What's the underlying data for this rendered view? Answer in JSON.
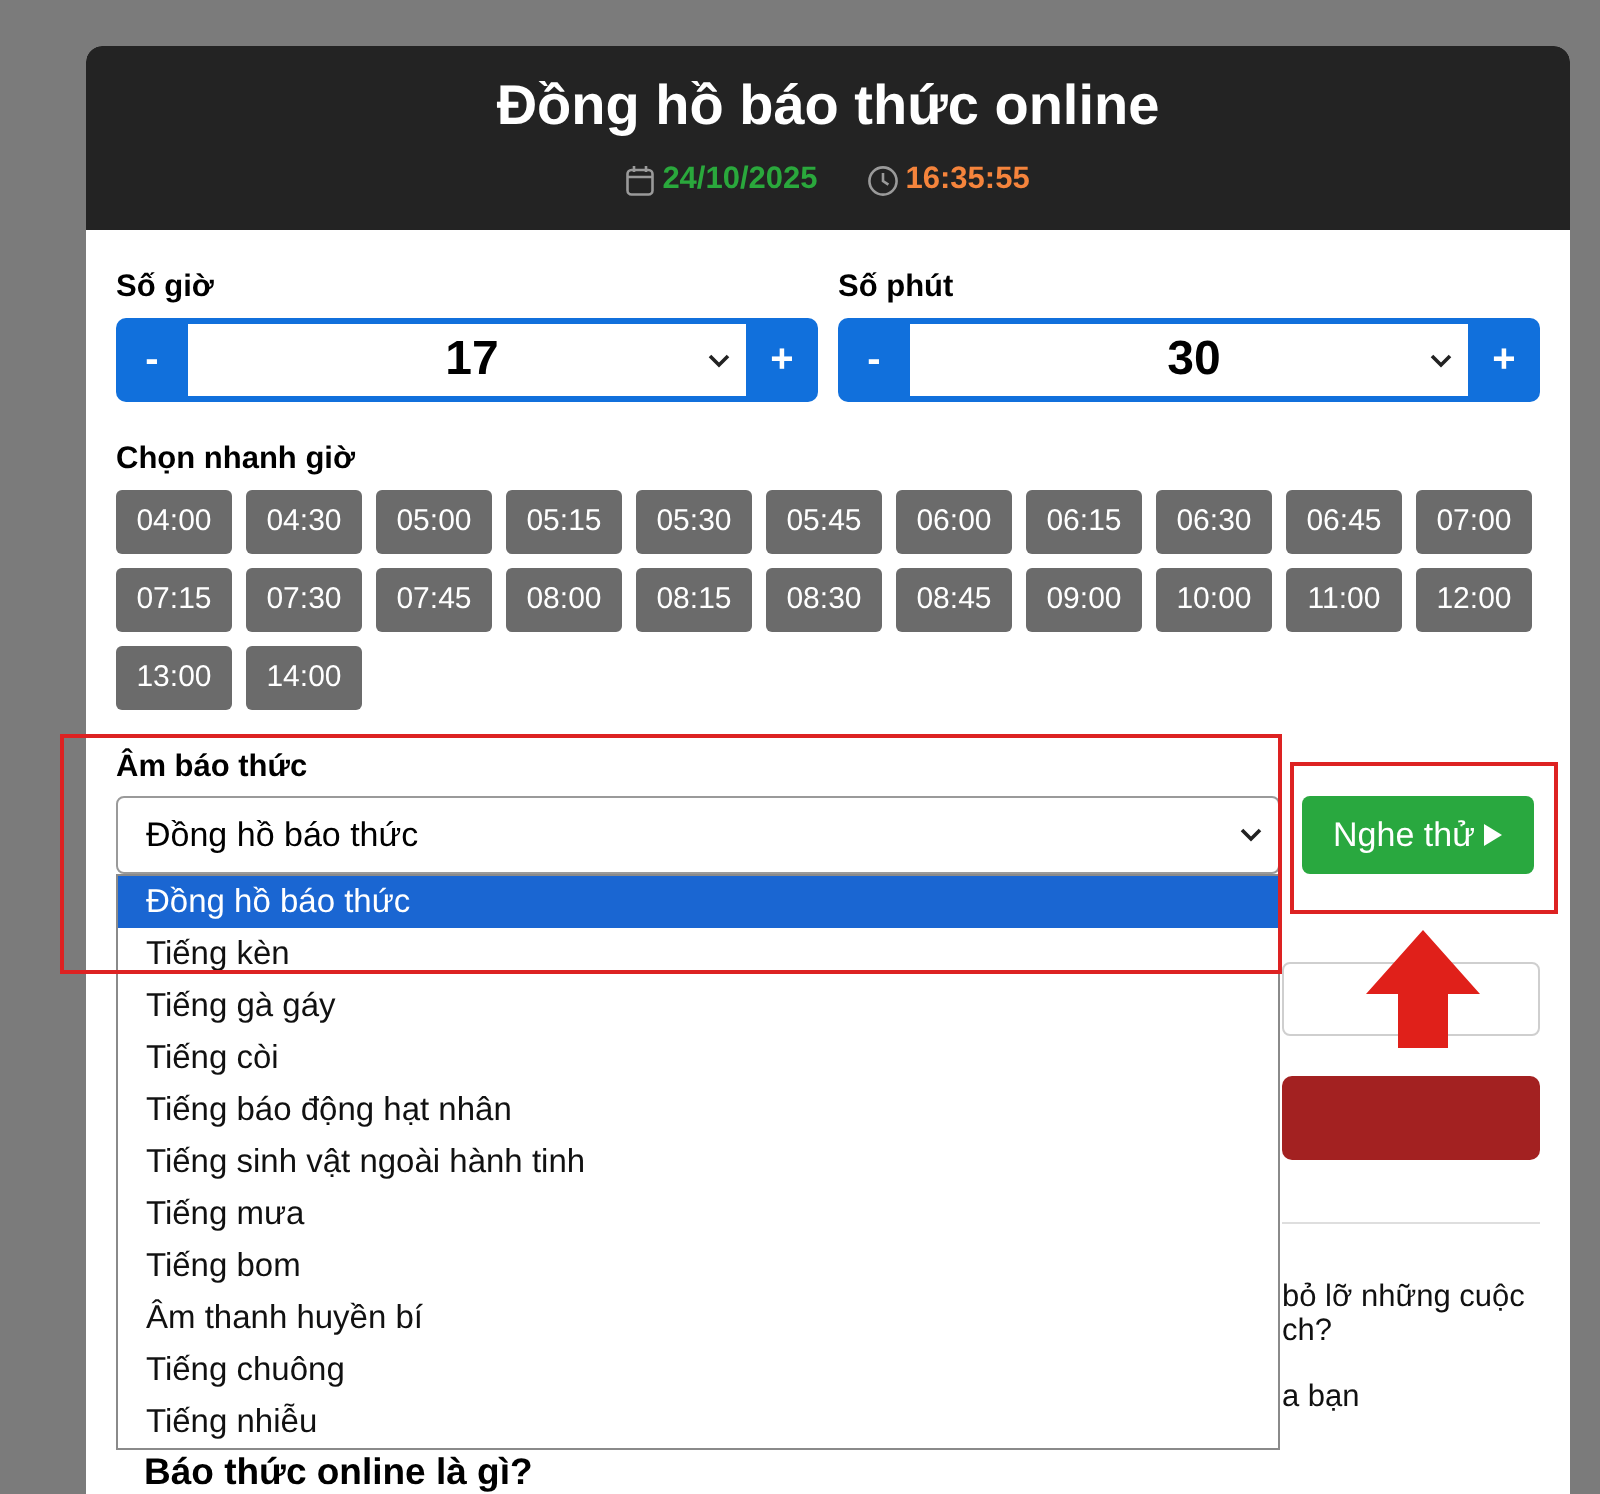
{
  "header": {
    "title": "Đồng hồ báo thức online",
    "date": "24/10/2025",
    "time": "16:35:55"
  },
  "time_pickers": [
    {
      "label": "Số giờ",
      "decrement": "-",
      "value": "17",
      "increment": "+"
    },
    {
      "label": "Số phút",
      "decrement": "-",
      "value": "30",
      "increment": "+"
    }
  ],
  "quick_pick": {
    "label": "Chọn nhanh giờ",
    "times": [
      "04:00",
      "04:30",
      "05:00",
      "05:15",
      "05:30",
      "05:45",
      "06:00",
      "06:15",
      "06:30",
      "06:45",
      "07:00",
      "07:15",
      "07:30",
      "07:45",
      "08:00",
      "08:15",
      "08:30",
      "08:45",
      "09:00",
      "10:00",
      "11:00",
      "12:00",
      "13:00",
      "14:00"
    ]
  },
  "sound": {
    "label": "Âm báo thức",
    "value": "Đồng hồ báo thức",
    "expanded": true,
    "options": [
      {
        "label": "Đồng hồ báo thức",
        "selected": true
      },
      {
        "label": "Tiếng kèn",
        "selected": false
      },
      {
        "label": "Tiếng gà gáy",
        "selected": false
      },
      {
        "label": "Tiếng còi",
        "selected": false
      },
      {
        "label": "Tiếng báo động hạt nhân",
        "selected": false
      },
      {
        "label": "Tiếng sinh vật ngoài hành tinh",
        "selected": false
      },
      {
        "label": "Tiếng mưa",
        "selected": false
      },
      {
        "label": "Tiếng bom",
        "selected": false
      },
      {
        "label": "Âm thanh huyền bí",
        "selected": false
      },
      {
        "label": "Tiếng chuông",
        "selected": false
      },
      {
        "label": "Tiếng nhiễu",
        "selected": false
      }
    ],
    "preview_button": "Nghe thử"
  },
  "covered_paragraphs": [
    {
      "lines": [
        "bỏ lỡ những cuộc",
        "ch?"
      ]
    },
    {
      "lines": [
        "a bạn"
      ]
    }
  ],
  "section_heading": "Báo thức online là gì?",
  "annotations": [
    {
      "kind": "frame"
    },
    {
      "kind": "frame"
    },
    {
      "kind": "arrow"
    }
  ]
}
